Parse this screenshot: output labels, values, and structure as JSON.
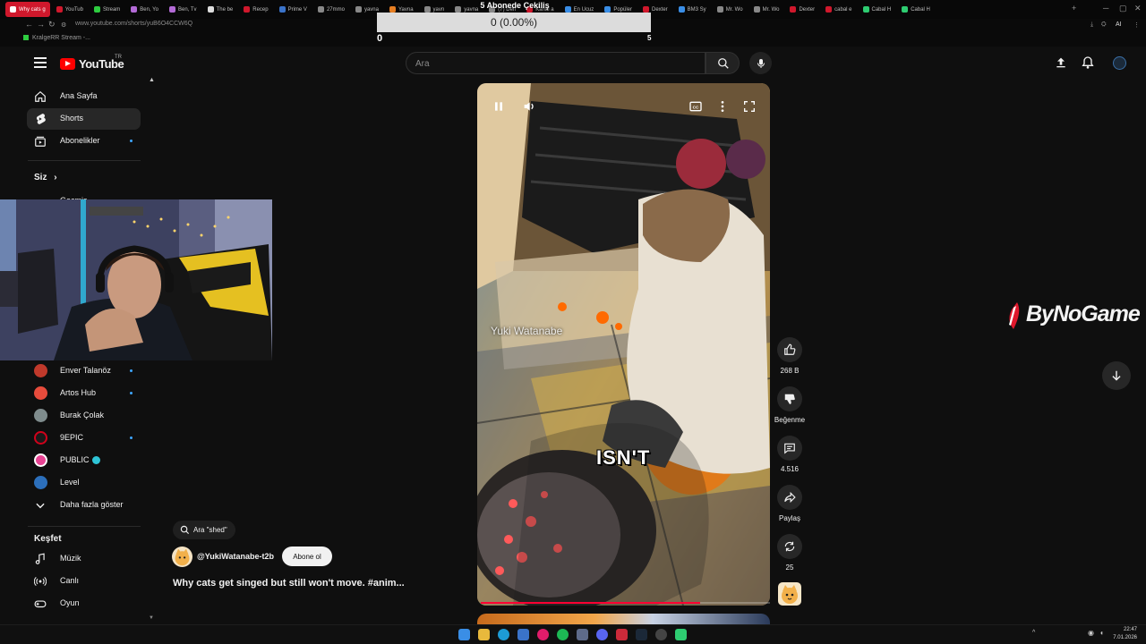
{
  "overlay": {
    "goal_title": "5 Abonede Çekiliş",
    "goal_progress": "0 (0.00%)",
    "goal_fraction": 0,
    "goal_min": "0",
    "goal_max": "5"
  },
  "browser": {
    "active_tab": "Why cats g",
    "tabs": [
      "YouTub",
      "Stream",
      "Ben, Yo",
      "Ben, Tv",
      "The be",
      "Recep",
      "Prime V",
      "27mmo",
      "yavna",
      "Yavna",
      "yavn",
      "yavna",
      "(7) Den",
      "Kanal a",
      "En Ucuz",
      "Popüler",
      "Dexter",
      "BM3 Sy",
      "Mr. Wo",
      "Mr. Wo",
      "Dexter",
      "cabal e",
      "Cabal H",
      "Cabal H"
    ],
    "url": "www.youtube.com/shorts/yuB6O4CCW6Q",
    "bookmark": "KralgeRR Stream -...",
    "toolbar_right": "AI"
  },
  "youtube": {
    "logo_word": "YouTube",
    "country": "TR",
    "search_placeholder": "Ara"
  },
  "sidebar": {
    "main": [
      {
        "label": "Ana Sayfa",
        "icon": "home-icon"
      },
      {
        "label": "Shorts",
        "icon": "shorts-icon"
      },
      {
        "label": "Abonelikler",
        "icon": "subscriptions-icon"
      }
    ],
    "you_heading": "Siz",
    "partial_item": "Geçmiş",
    "subscriptions": [
      {
        "label": "Enver Talanöz",
        "color": "#c0392b"
      },
      {
        "label": "Artos Hub",
        "color": "#e74c3c"
      },
      {
        "label": "Burak Çolak",
        "color": "#7f8c8d"
      },
      {
        "label": "9EPIC",
        "color": "#d0021b"
      },
      {
        "label": "PUBLIC",
        "color": "#e84393"
      },
      {
        "label": "Level",
        "color": "#2c6fbb"
      }
    ],
    "show_more": "Daha fazla göster",
    "explore_heading": "Keşfet",
    "explore": [
      {
        "label": "Müzik",
        "icon": "music-icon"
      },
      {
        "label": "Canlı",
        "icon": "live-icon"
      },
      {
        "label": "Oyun",
        "icon": "gaming-icon"
      }
    ]
  },
  "video": {
    "author_overlay": "Yuki Watanabe",
    "caption": "ISN'T",
    "progress_fraction": 0.76
  },
  "actions": {
    "likes": "268 B",
    "dislike_label": "Beğenme",
    "comments": "4.516",
    "share_label": "Paylaş",
    "remix_count": "25"
  },
  "info": {
    "search_chip": "Ara \"shed\"",
    "channel_handle": "@YukiWatanabe-t2b",
    "subscribe_label": "Abone ol",
    "title": "Why cats get singed but still won't move. #anim..."
  },
  "branding": {
    "sponsor": "ByNoGame"
  },
  "taskbar": {
    "time": "22:47",
    "date": "7.01.2026"
  },
  "colors": {
    "accent_red": "#ff0000",
    "subscribe_dot": "#3ea6ff",
    "active_tab": "#d0182c"
  }
}
